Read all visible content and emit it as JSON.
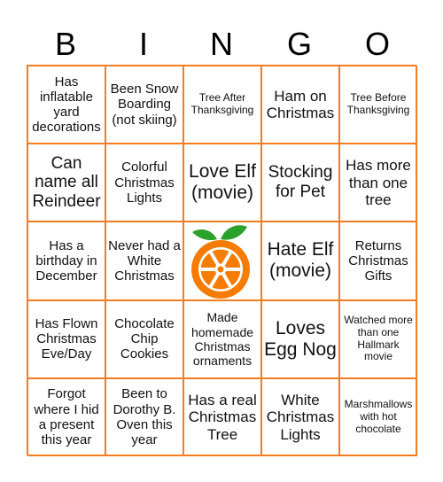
{
  "header": [
    "B",
    "I",
    "N",
    "G",
    "O"
  ],
  "accent_color": "#f57c20",
  "free_space_icon": "orange-slice-icon",
  "cells": [
    "Has inflatable yard decorations",
    "Been Snow Boarding (not skiing)",
    "Tree After Thanksgiving",
    "Ham on Christmas",
    "Tree Before Thanksgiving",
    "Can name all Reindeer",
    "Colorful Christmas Lights",
    "Love Elf (movie)",
    "Stocking for Pet",
    "Has more than one tree",
    "Has a birthday in December",
    "Never had a White Christmas",
    "",
    "Hate Elf (movie)",
    "Returns Christmas Gifts",
    "Has Flown Christmas Eve/Day",
    "Chocolate Chip Cookies",
    "Made homemade Christmas ornaments",
    "Loves Egg Nog",
    "Watched more than one Hallmark movie",
    "Forgot where I hid a present this year",
    "Been to Dorothy B. Oven this year",
    "Has a real Christmas Tree",
    "White Christmas Lights",
    "Marshmallows with hot chocolate"
  ]
}
